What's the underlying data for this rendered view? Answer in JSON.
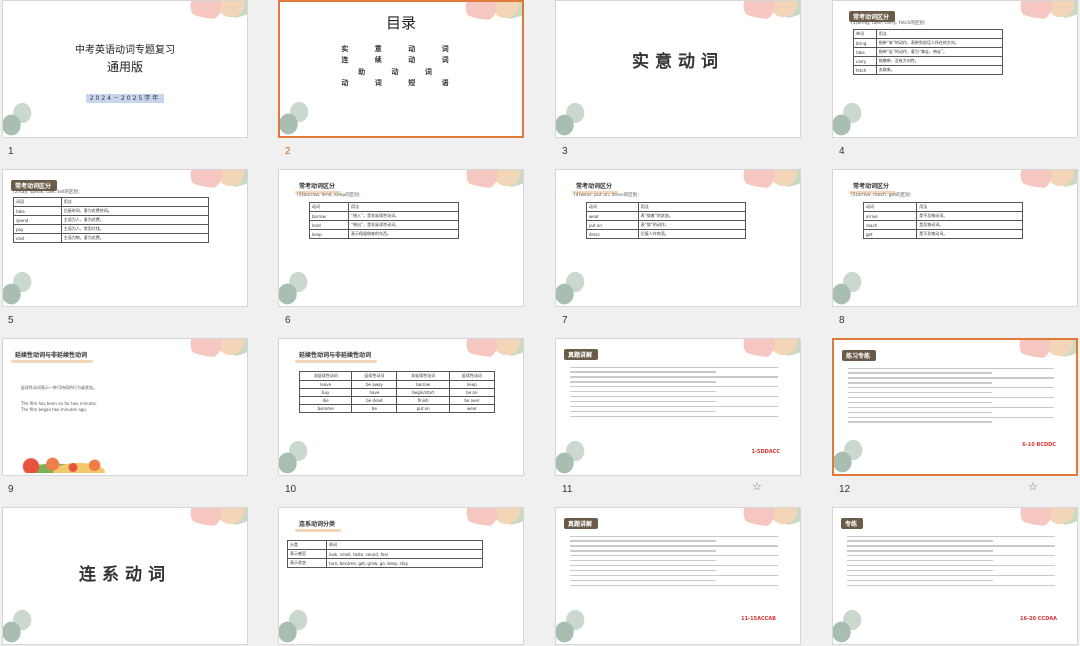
{
  "slides": [
    {
      "num": "1",
      "title1": "中考英语动词专题复习",
      "title2": "通用版",
      "date": "2024－2025学年"
    },
    {
      "num": "2",
      "title": "目录",
      "items": [
        "实 意 动 词",
        "连 续 动 词",
        "助 动 词",
        "动 词 短 语"
      ]
    },
    {
      "num": "3",
      "title": "实意动词"
    },
    {
      "num": "4",
      "header": "常考动词区分",
      "sub": "(1)bring, take, carry, fetch的区别：",
      "col1": "单词",
      "col2": "用法",
      "rows": [
        [
          "bring",
          "指带“来”的动作，表带到说话人所在的方向。"
        ],
        [
          "take",
          "指带“走”的动作，意为“拿走，带走”。"
        ],
        [
          "carry",
          "指携带，没有方向性。"
        ],
        [
          "fetch",
          "去取来。"
        ]
      ]
    },
    {
      "num": "5",
      "header": "常考动词区分",
      "sub": "(2)say, speak, talk, tell的区别：",
      "col1": "词语",
      "col2": "用法",
      "rows": [
        [
          "take",
          "后接时间，意为花费时间。"
        ],
        [
          "spend",
          "主语为人，意为花费。"
        ],
        [
          "pay",
          "主语为人，常用付钱。"
        ],
        [
          "cost",
          "主语为物，意为花费。"
        ]
      ]
    },
    {
      "num": "6",
      "header": "常考动词区分",
      "sub": "(3)borrow, lend, keep的区别：",
      "col1": "动词",
      "col2": "用法",
      "rows": [
        [
          "borrow",
          "“借入”，是非延续性动词。"
        ],
        [
          "lend",
          "“借出”，是非延续性动词。"
        ],
        [
          "keep",
          "表示保留借来的东西。"
        ]
      ]
    },
    {
      "num": "7",
      "header": "常考动词区分",
      "sub": "(4)wear, put on, dress的区别：",
      "col1": "动词",
      "col2": "用法",
      "rows": [
        [
          "wear",
          "表“穿着”的状态。"
        ],
        [
          "put on",
          "表“穿”的动作。"
        ],
        [
          "dress",
          "后接人作宾语。"
        ]
      ]
    },
    {
      "num": "8",
      "header": "常考动词区分",
      "sub": "(5)arrive, reach, get的区别：",
      "col1": "动词",
      "col2": "用法",
      "rows": [
        [
          "arrive",
          "是不及物动词。"
        ],
        [
          "reach",
          "是及物动词。"
        ],
        [
          "get",
          "是不及物动词。"
        ]
      ]
    },
    {
      "num": "9",
      "header": "延续性动词与非延续性动词",
      "para1": "延续性动词表示一种可持续的行为或状态。",
      "para2": "The film has been on for two minutes.",
      "para3": "The film began two minutes ago."
    },
    {
      "num": "10",
      "header": "延续性动词与非延续性动词",
      "cols": [
        "非延续性动词",
        "延续性动词",
        "非延续性动词",
        "延续性动词"
      ],
      "rows": [
        [
          "leave",
          "be away",
          "borrow",
          "keep"
        ],
        [
          "buy",
          "have",
          "begin/start",
          "be on"
        ],
        [
          "die",
          "be dead",
          "finish",
          "be over"
        ],
        [
          "become",
          "be",
          "put on",
          "wear"
        ]
      ]
    },
    {
      "num": "11",
      "header": "真题讲解",
      "tag": "1-5DDACC"
    },
    {
      "num": "12",
      "header": "练习专练",
      "tag": "6-10 BCDDC"
    },
    {
      "num": "13",
      "title": "连系动词"
    },
    {
      "num": "14",
      "header": "连系动词分类",
      "col1": "分类",
      "col2": "例词",
      "rows": [
        [
          "表示感官",
          "look, smell, taste, sound, feel"
        ],
        [
          "表示状态",
          "turn, become, get, grow, go, keep, stay"
        ]
      ]
    },
    {
      "num": "15",
      "header": "真题讲解",
      "tag": "11-15ACCAB"
    },
    {
      "num": "16",
      "header": "专练",
      "tag": "16-20 CCDAA"
    }
  ],
  "icons": {
    "star": "star-icon"
  }
}
